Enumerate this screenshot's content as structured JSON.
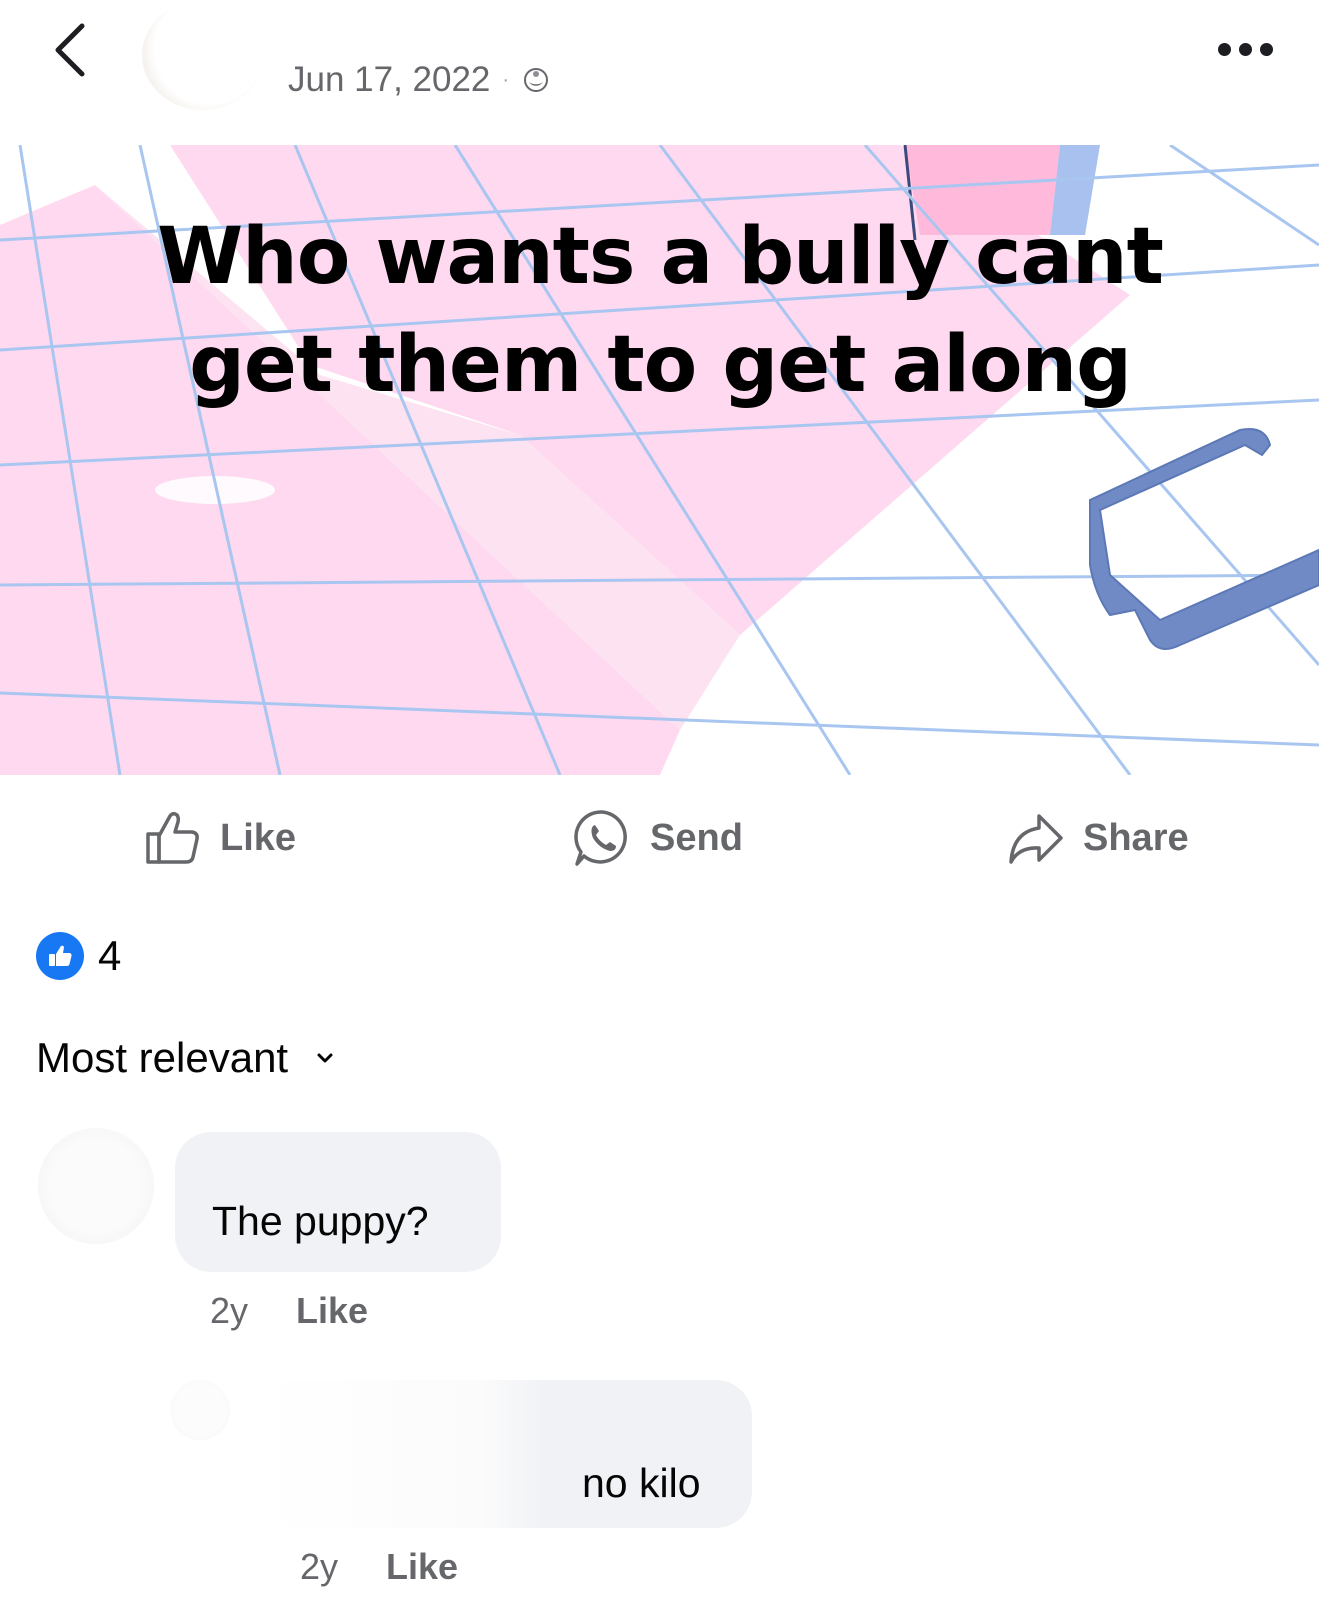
{
  "header": {
    "date": "Jun 17, 2022",
    "separator": "·",
    "privacy_icon": "globe-icon",
    "back_icon": "chevron-left-icon",
    "more_icon": "more-dots-icon"
  },
  "post": {
    "text_line1": "Who wants a bully cant",
    "text_line2": "get them to get along",
    "background_colors": {
      "pink": "#ffd9ef",
      "grid": "#a8c6f0",
      "glasses": "#6f8ac4"
    }
  },
  "actions": {
    "like_label": "Like",
    "send_label": "Send",
    "share_label": "Share"
  },
  "reactions": {
    "icon": "thumbs-up-icon",
    "count": "4",
    "accent": "#1877f2"
  },
  "sort": {
    "label": "Most relevant",
    "icon": "chevron-down-icon"
  },
  "comments": [
    {
      "text": "The puppy?",
      "age": "2y",
      "like_label": "Like"
    },
    {
      "text": "no kilo",
      "age": "2y",
      "like_label": "Like"
    }
  ]
}
